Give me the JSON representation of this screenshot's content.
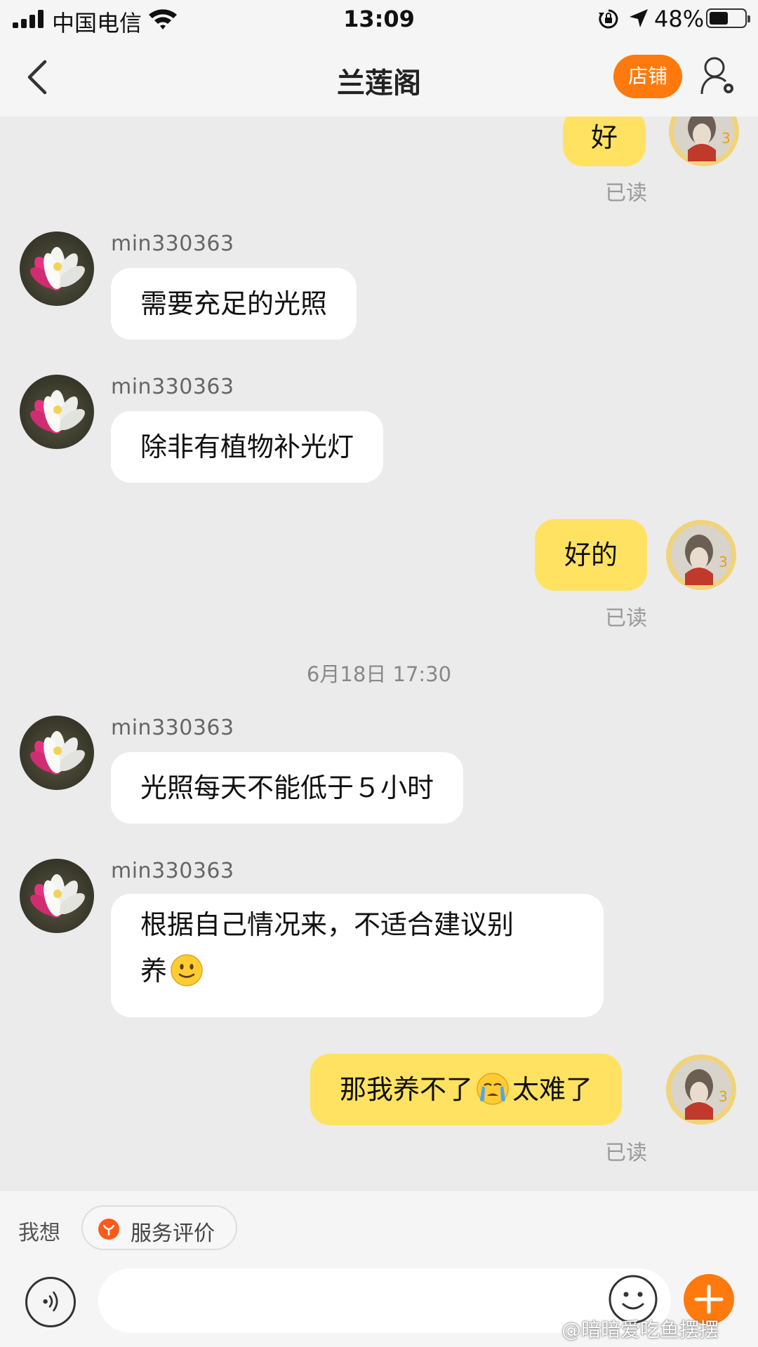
{
  "status_bar": {
    "carrier": "中国电信",
    "time": "13:09",
    "battery": "48%"
  },
  "nav": {
    "title": "兰莲阁",
    "shop_button": "店铺"
  },
  "messages": [
    {
      "text": "好",
      "read": "已读"
    },
    {
      "sender": "min330363",
      "text": "需要充足的光照"
    },
    {
      "sender": "min330363",
      "text": "除非有植物补光灯"
    },
    {
      "text": "好的",
      "read": "已读"
    },
    {
      "sender": "min330363",
      "text": "光照每天不能低于５小时"
    },
    {
      "sender": "min330363",
      "text_line1": "根据自己情况来，不适合建议别",
      "text_line2": "养"
    },
    {
      "text_part1": "那我养不了",
      "text_part2": "太难了",
      "read": "已读"
    }
  ],
  "timestamp": "6月18日 17:30",
  "quick_actions": {
    "prefix": "我想",
    "rate_label": "服务评价"
  },
  "input": {
    "placeholder": ""
  },
  "watermark": "@暗暗爱吃鱼摆摆",
  "colors": {
    "accent": "#ff7a0e",
    "outgoing_bubble": "#ffe262",
    "incoming_bubble": "#ffffff",
    "background": "#ebebeb"
  },
  "icons": [
    "signal-icon",
    "wifi-icon",
    "orientation-lock-icon",
    "location-icon",
    "battery-icon",
    "back-icon",
    "profile-settings-icon",
    "voice-icon",
    "emoji-icon",
    "plus-icon",
    "smile-emoji",
    "crying-emoji"
  ]
}
